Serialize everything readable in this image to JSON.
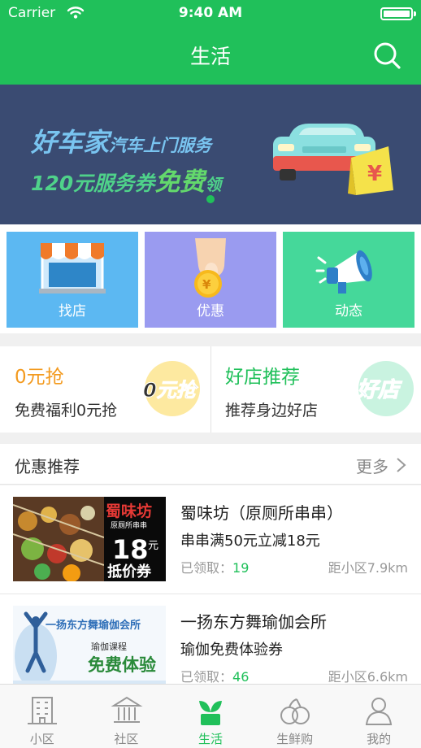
{
  "status_bar": {
    "carrier": "Carrier",
    "time": "9:40 AM"
  },
  "nav": {
    "title": "生活",
    "search_icon": "search-icon"
  },
  "banner": {
    "brand": "好车家",
    "service": "汽车上门服务",
    "amount": "120元",
    "coupon": "服务券",
    "free": "免费",
    "take": "领",
    "price_tag": "¥",
    "page_index": 1,
    "page_count": 1
  },
  "tiles": [
    {
      "label": "找店",
      "color": "#5cb8f2",
      "icon": "shop-icon"
    },
    {
      "label": "优惠",
      "color": "#9a9bf0",
      "icon": "coin-icon"
    },
    {
      "label": "动态",
      "color": "#45d89a",
      "icon": "megaphone-icon"
    }
  ],
  "promos": [
    {
      "title": "0元抢",
      "subtitle": "免费福利0元抢",
      "badge": "0元抢",
      "title_color": "#f39a1e"
    },
    {
      "title": "好店推荐",
      "subtitle": "推荐身边好店",
      "badge": "好店",
      "title_color": "#20c05a"
    }
  ],
  "section": {
    "title": "优惠推荐",
    "more": "更多"
  },
  "deals": [
    {
      "title": "蜀味坊（原厕所串串）",
      "deal": "串串满50元立减18元",
      "claimed_label": "已领取：",
      "claimed_count": "19",
      "distance": "距小区7.9km",
      "thumb": {
        "name": "蜀味坊",
        "sub": "原厕所串串",
        "price": "18",
        "unit": "元",
        "tag": "抵价券"
      }
    },
    {
      "title": "一扬东方舞瑜伽会所",
      "deal": "瑜伽免费体验券",
      "claimed_label": "已领取：",
      "claimed_count": "46",
      "distance": "距小区6.6km",
      "thumb": {
        "name": "一扬东方舞瑜伽会所",
        "course": "瑜伽课程",
        "offer": "免费体验"
      }
    }
  ],
  "tabbar": [
    {
      "label": "小区",
      "icon": "building-icon",
      "active": false
    },
    {
      "label": "社区",
      "icon": "hall-icon",
      "active": false
    },
    {
      "label": "生活",
      "icon": "sprout-icon",
      "active": true
    },
    {
      "label": "生鲜购",
      "icon": "fruit-icon",
      "active": false
    },
    {
      "label": "我的",
      "icon": "person-icon",
      "active": false
    }
  ],
  "colors": {
    "brand": "#20c05a",
    "banner_bg": "#3a4b72",
    "muted": "#999999"
  }
}
